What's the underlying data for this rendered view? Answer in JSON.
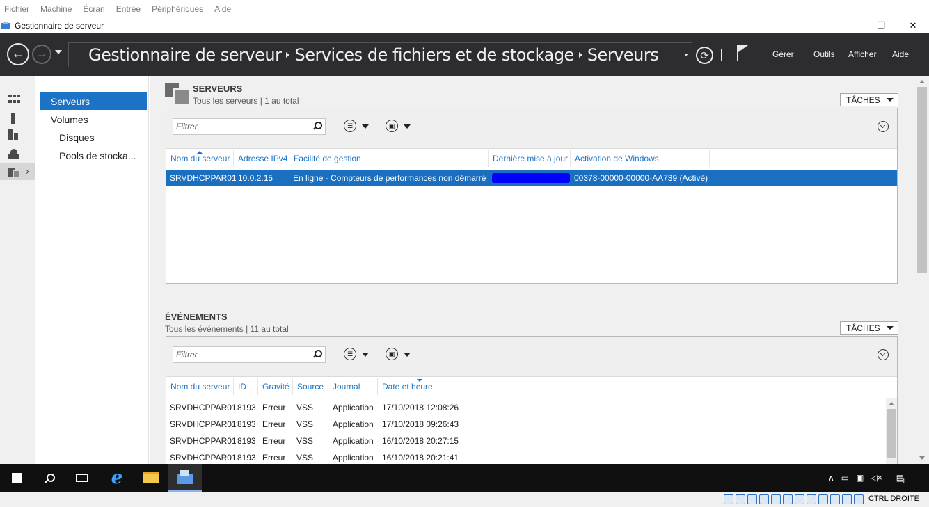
{
  "host_menu": [
    "Fichier",
    "Machine",
    "Écran",
    "Entrée",
    "Périphériques",
    "Aide"
  ],
  "window": {
    "title": "Gestionnaire de serveur",
    "controls": [
      "—",
      "❐",
      "✕"
    ]
  },
  "header": {
    "breadcrumb": [
      "Gestionnaire de serveur",
      "Services de fichiers et de stockage",
      "Serveurs"
    ],
    "menu": [
      "Gérer",
      "Outils",
      "Afficher",
      "Aide"
    ]
  },
  "icon_strip": [
    {
      "icon": "dashboard-icon"
    },
    {
      "icon": "local-server-icon"
    },
    {
      "icon": "all-servers-icon"
    },
    {
      "icon": "roles-icon"
    },
    {
      "icon": "file-storage-icon",
      "active": true
    }
  ],
  "subnav": {
    "items": [
      {
        "label": "Serveurs",
        "level": 1,
        "selected": true
      },
      {
        "label": "Volumes",
        "level": 1
      },
      {
        "label": "Disques",
        "level": 2
      },
      {
        "label": "Pools de stocka...",
        "level": 2
      }
    ]
  },
  "servers": {
    "title": "SERVEURS",
    "subtitle": "Tous les serveurs | 1 au total",
    "tasks_label": "TÂCHES",
    "filter_placeholder": "Filtrer",
    "columns": [
      "Nom du serveur",
      "Adresse IPv4",
      "Facilité de gestion",
      "Dernière mise à jour",
      "Activation de Windows"
    ],
    "rows": [
      {
        "name": "SRVDHCPPAR01",
        "ip": "10.0.2.15",
        "manageability": "En ligne - Compteurs de performances non démarré",
        "last_update": "",
        "activation": "00378-00000-00000-AA739 (Activé)"
      }
    ]
  },
  "events": {
    "title": "ÉVÉNEMENTS",
    "subtitle": "Tous les événements | 11 au total",
    "tasks_label": "TÂCHES",
    "filter_placeholder": "Filtrer",
    "columns": [
      "Nom du serveur",
      "ID",
      "Gravité",
      "Source",
      "Journal",
      "Date et heure"
    ],
    "rows": [
      {
        "server": "SRVDHCPPAR01",
        "id": "8193",
        "severity": "Erreur",
        "source": "VSS",
        "log": "Application",
        "date": "17/10/2018 12:08:26"
      },
      {
        "server": "SRVDHCPPAR01",
        "id": "8193",
        "severity": "Erreur",
        "source": "VSS",
        "log": "Application",
        "date": "17/10/2018 09:26:43"
      },
      {
        "server": "SRVDHCPPAR01",
        "id": "8193",
        "severity": "Erreur",
        "source": "VSS",
        "log": "Application",
        "date": "16/10/2018 20:27:15"
      },
      {
        "server": "SRVDHCPPAR01",
        "id": "8193",
        "severity": "Erreur",
        "source": "VSS",
        "log": "Application",
        "date": "16/10/2018 20:21:41"
      }
    ]
  },
  "taskbar": {
    "notification_count": "1"
  },
  "vbox_status": {
    "host_key": "CTRL DROITE"
  },
  "colors": {
    "accent": "#1a73c7",
    "header_bg": "#2d2d30",
    "selection": "#1a6fc0"
  }
}
